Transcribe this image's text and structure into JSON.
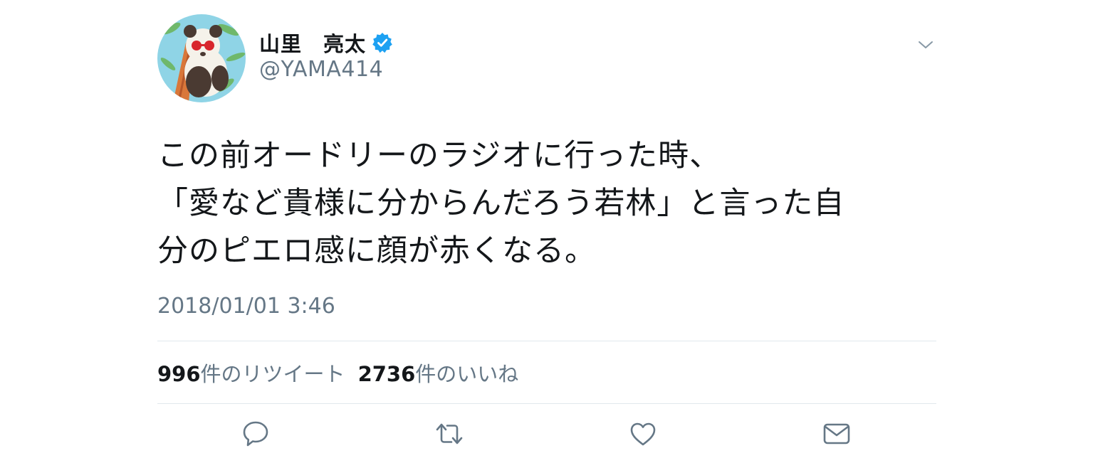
{
  "user": {
    "display_name": "山里　亮太",
    "handle": "@YAMA414",
    "verified": true,
    "avatar_icon": "panda-avatar"
  },
  "tweet": {
    "lines": [
      "この前オードリーのラジオに行った時、",
      "「愛など貴様に分からんだろう若林」と言った自",
      "分のピエロ感に顔が赤くなる。"
    ],
    "timestamp": "2018/01/01 3:46"
  },
  "stats": {
    "retweets": {
      "count": "996",
      "label": "件のリツイート"
    },
    "likes": {
      "count": "2736",
      "label": "件のいいね"
    }
  },
  "actions": [
    "reply-icon",
    "retweet-icon",
    "like-icon",
    "direct-message-icon"
  ],
  "colors": {
    "text_primary": "#14171a",
    "text_secondary": "#657786",
    "verified_blue": "#1da1f2",
    "divider": "#e1e8ed"
  }
}
